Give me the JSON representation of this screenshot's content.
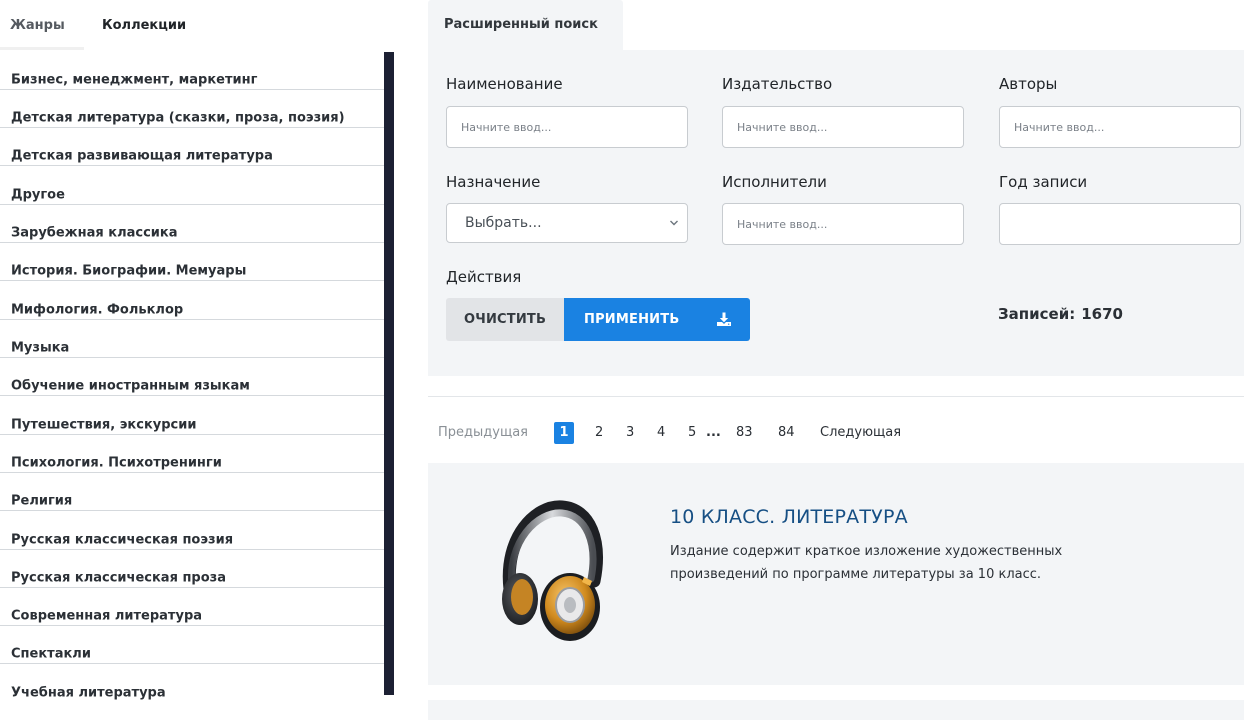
{
  "sidebar": {
    "tabs": [
      {
        "label": "Жанры"
      },
      {
        "label": "Коллекции"
      }
    ],
    "items": [
      {
        "label": "Бизнес, менеджмент, маркетинг"
      },
      {
        "label": "Детская литература (сказки, проза, поэзия)"
      },
      {
        "label": "Детская развивающая литература"
      },
      {
        "label": "Другое"
      },
      {
        "label": "Зарубежная классика"
      },
      {
        "label": "История. Биографии. Мемуары"
      },
      {
        "label": "Мифология. Фольклор"
      },
      {
        "label": "Музыка"
      },
      {
        "label": "Обучение иностранным языкам"
      },
      {
        "label": "Путешествия, экскурсии"
      },
      {
        "label": "Психология. Психотренинги"
      },
      {
        "label": "Религия"
      },
      {
        "label": "Русская классическая поэзия"
      },
      {
        "label": "Русская классическая проза"
      },
      {
        "label": "Современная литература"
      },
      {
        "label": "Спектакли"
      },
      {
        "label": "Учебная литература"
      }
    ]
  },
  "search": {
    "tab_label": "Расширенный поиск",
    "fields": {
      "title": {
        "label": "Наименование",
        "placeholder": "Начните ввод..."
      },
      "publisher": {
        "label": "Издательство",
        "placeholder": "Начните ввод..."
      },
      "authors": {
        "label": "Авторы",
        "placeholder": "Начните ввод..."
      },
      "purpose": {
        "label": "Назначение",
        "value": "Выбрать..."
      },
      "performers": {
        "label": "Исполнители",
        "placeholder": "Начните ввод..."
      },
      "year": {
        "label": "Год записи",
        "placeholder": ""
      }
    },
    "actions_label": "Действия",
    "clear_label": "ОЧИСТИТЬ",
    "apply_label": "ПРИМЕНИТЬ",
    "records_label": "Записей:",
    "records_count": "1670"
  },
  "pagination": {
    "prev": "Предыдущая",
    "pages": [
      "1",
      "2",
      "3",
      "4",
      "5"
    ],
    "ellipsis": "...",
    "tail_pages": [
      "83",
      "84"
    ],
    "current": "1",
    "next": "Следующая"
  },
  "results": [
    {
      "title": "10 КЛАСС. ЛИТЕРАТУРА",
      "description": "Издание содержит краткое изложение художественных произведений по программе литературы за 10 класс.",
      "icon": "headphones-icon"
    }
  ],
  "colors": {
    "accent": "#1a82e2",
    "title": "#164f84",
    "panel": "#f3f5f7",
    "scrollbar": "#1c2033"
  }
}
